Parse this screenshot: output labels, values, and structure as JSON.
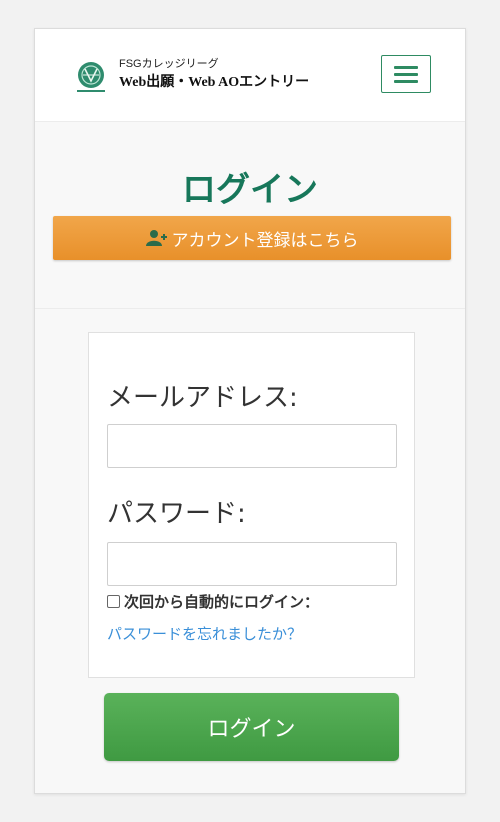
{
  "header": {
    "logo_line1": "FSGカレッジリーグ",
    "logo_line2": "Web出願・Web AOエントリー",
    "logo_emblem_text": "FSG COLLEGE LEAGUE",
    "menu_icon": "hamburger-icon"
  },
  "hero": {
    "title": "ログイン",
    "register_label": "アカウント登録はこちら",
    "register_icon": "add-user-icon"
  },
  "form": {
    "email_label": "メールアドレス:",
    "email_value": "",
    "password_label": "パスワード:",
    "password_value": "",
    "remember_label": "次回から自動的にログイン：",
    "forgot_label": "パスワードを忘れましたか？"
  },
  "login_button": "ログイン",
  "colors": {
    "title_green": "#17775a",
    "menu_green": "#2e8b62",
    "register_orange": "#e8902a",
    "login_green": "#4caf50",
    "link_blue": "#3a8fd8"
  }
}
